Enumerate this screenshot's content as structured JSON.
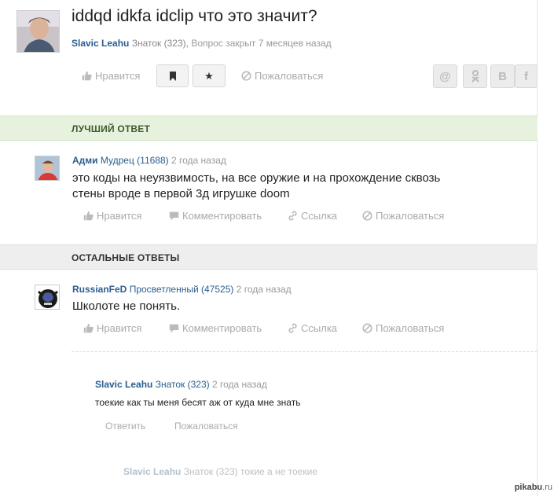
{
  "question": {
    "title": "iddqd idkfa idclip что это значит?",
    "author": "Slavic Leahu",
    "rank": "Знаток (323),",
    "status": "Вопрос закрыт 7 месяцев назад",
    "like_label": "Нравится",
    "report_label": "Пожаловаться",
    "share": {
      "mail": "@",
      "ok": "ok",
      "vk": "B",
      "fb": "f"
    }
  },
  "best_answer": {
    "section_label": "ЛУЧШИЙ ОТВЕТ",
    "author": "Адми",
    "rank": "Мудрец (11688)",
    "time": "2 года назад",
    "text_line1": "это коды на неуязвимость, на все оружие и на прохождение сквозь",
    "text_line2": "стены вроде в первой 3д игрушке doom",
    "like_label": "Нравится",
    "comment_label": "Комментировать",
    "link_label": "Ссылка",
    "report_label": "Пожаловаться"
  },
  "other_answers": {
    "section_label": "ОСТАЛЬНЫЕ ОТВЕТЫ",
    "items": [
      {
        "author": "RussianFeD",
        "rank": "Просветленный (47525)",
        "time": "2 года назад",
        "text": "Школоте не понять.",
        "like_label": "Нравится",
        "comment_label": "Комментировать",
        "link_label": "Ссылка",
        "report_label": "Пожаловаться"
      }
    ]
  },
  "comment": {
    "author": "Slavic Leahu",
    "rank": "Знаток (323)",
    "time": "2 года назад",
    "text": "тоекие как ты меня бесят аж от куда мне знать",
    "reply_label": "Ответить",
    "report_label": "Пожаловаться"
  },
  "comment_preview": {
    "author": "Slavic Leahu",
    "rank": "Знаток (323)",
    "text": "токие а не тоекие"
  },
  "watermark": {
    "brand": "pikabu",
    "suffix": ".ru"
  },
  "colors": {
    "author": "#2a5d8f",
    "muted": "#aaaaaa",
    "best_band": "#e6f2dd",
    "other_band": "#eeeeee"
  }
}
